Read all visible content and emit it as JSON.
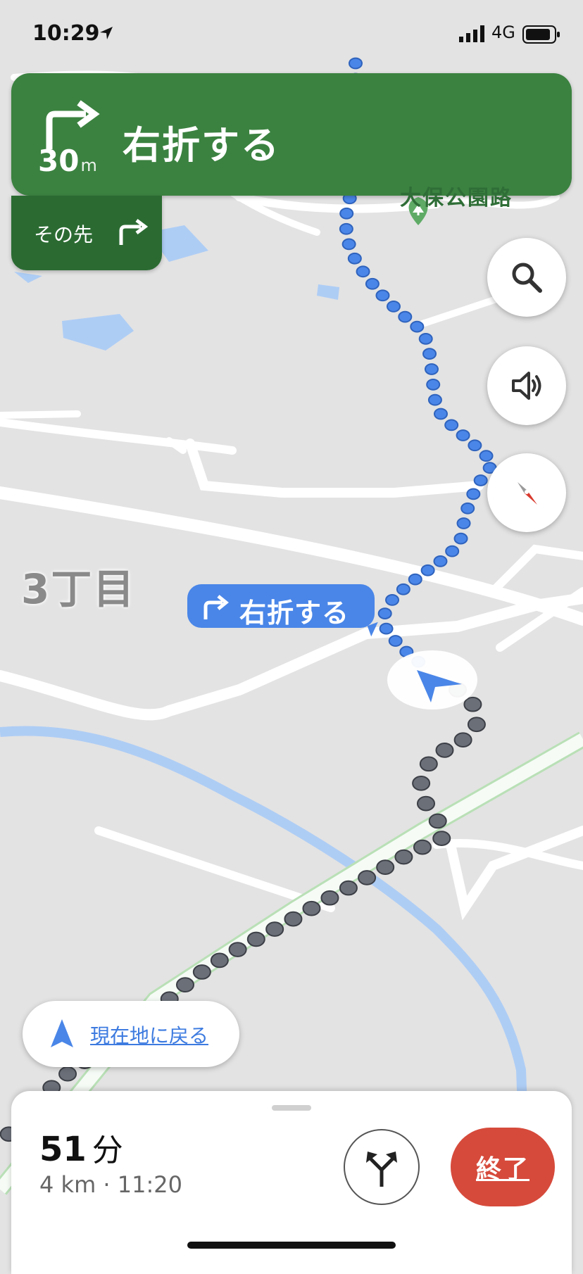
{
  "status_bar": {
    "time": "10:29",
    "network": "4G"
  },
  "navigation": {
    "distance_value": "30",
    "distance_unit": "m",
    "instruction": "右折する",
    "then_label": "その先"
  },
  "map": {
    "district_label": "3丁目",
    "park_label": "大保公園路",
    "maneuver_callout": "右折する"
  },
  "controls": {
    "search_icon": "search-icon",
    "sound_icon": "speaker-icon",
    "compass_icon": "compass-icon",
    "recenter_label": "現在地に戻る"
  },
  "trip": {
    "eta_value": "51",
    "eta_unit": "分",
    "distance_and_arrival": "4 km · 11:20",
    "end_button": "終了"
  },
  "colors": {
    "banner": "#3b8240",
    "then_panel": "#2b6b32",
    "route": "#4a86e8",
    "traveled": "#6b6f78",
    "end_button": "#d64a3b"
  }
}
